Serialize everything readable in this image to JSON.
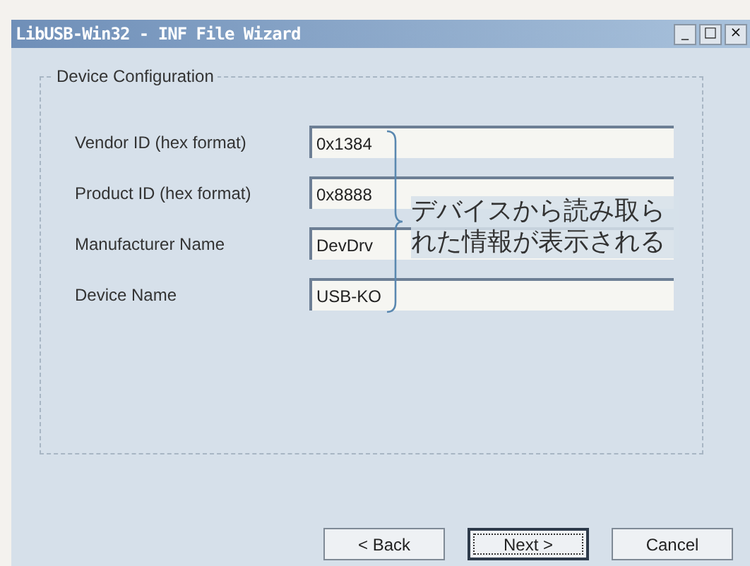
{
  "window": {
    "title": "LibUSB-Win32 - INF File Wizard",
    "controls": [
      "_",
      "□",
      "×"
    ]
  },
  "group": {
    "title": "Device Configuration"
  },
  "fields": [
    {
      "label": "Vendor ID (hex format)",
      "value": "0x1384"
    },
    {
      "label": "Product ID (hex format)",
      "value": "0x8888"
    },
    {
      "label": "Manufacturer Name",
      "value": "DevDrv"
    },
    {
      "label": "Device Name",
      "value": "USB-KO"
    }
  ],
  "annotation": {
    "text": "デバイスから読み取られた情報が表示される"
  },
  "buttons": [
    {
      "label": "< Back",
      "default": false
    },
    {
      "label": "Next >",
      "default": true
    },
    {
      "label": "Cancel",
      "default": false
    }
  ]
}
